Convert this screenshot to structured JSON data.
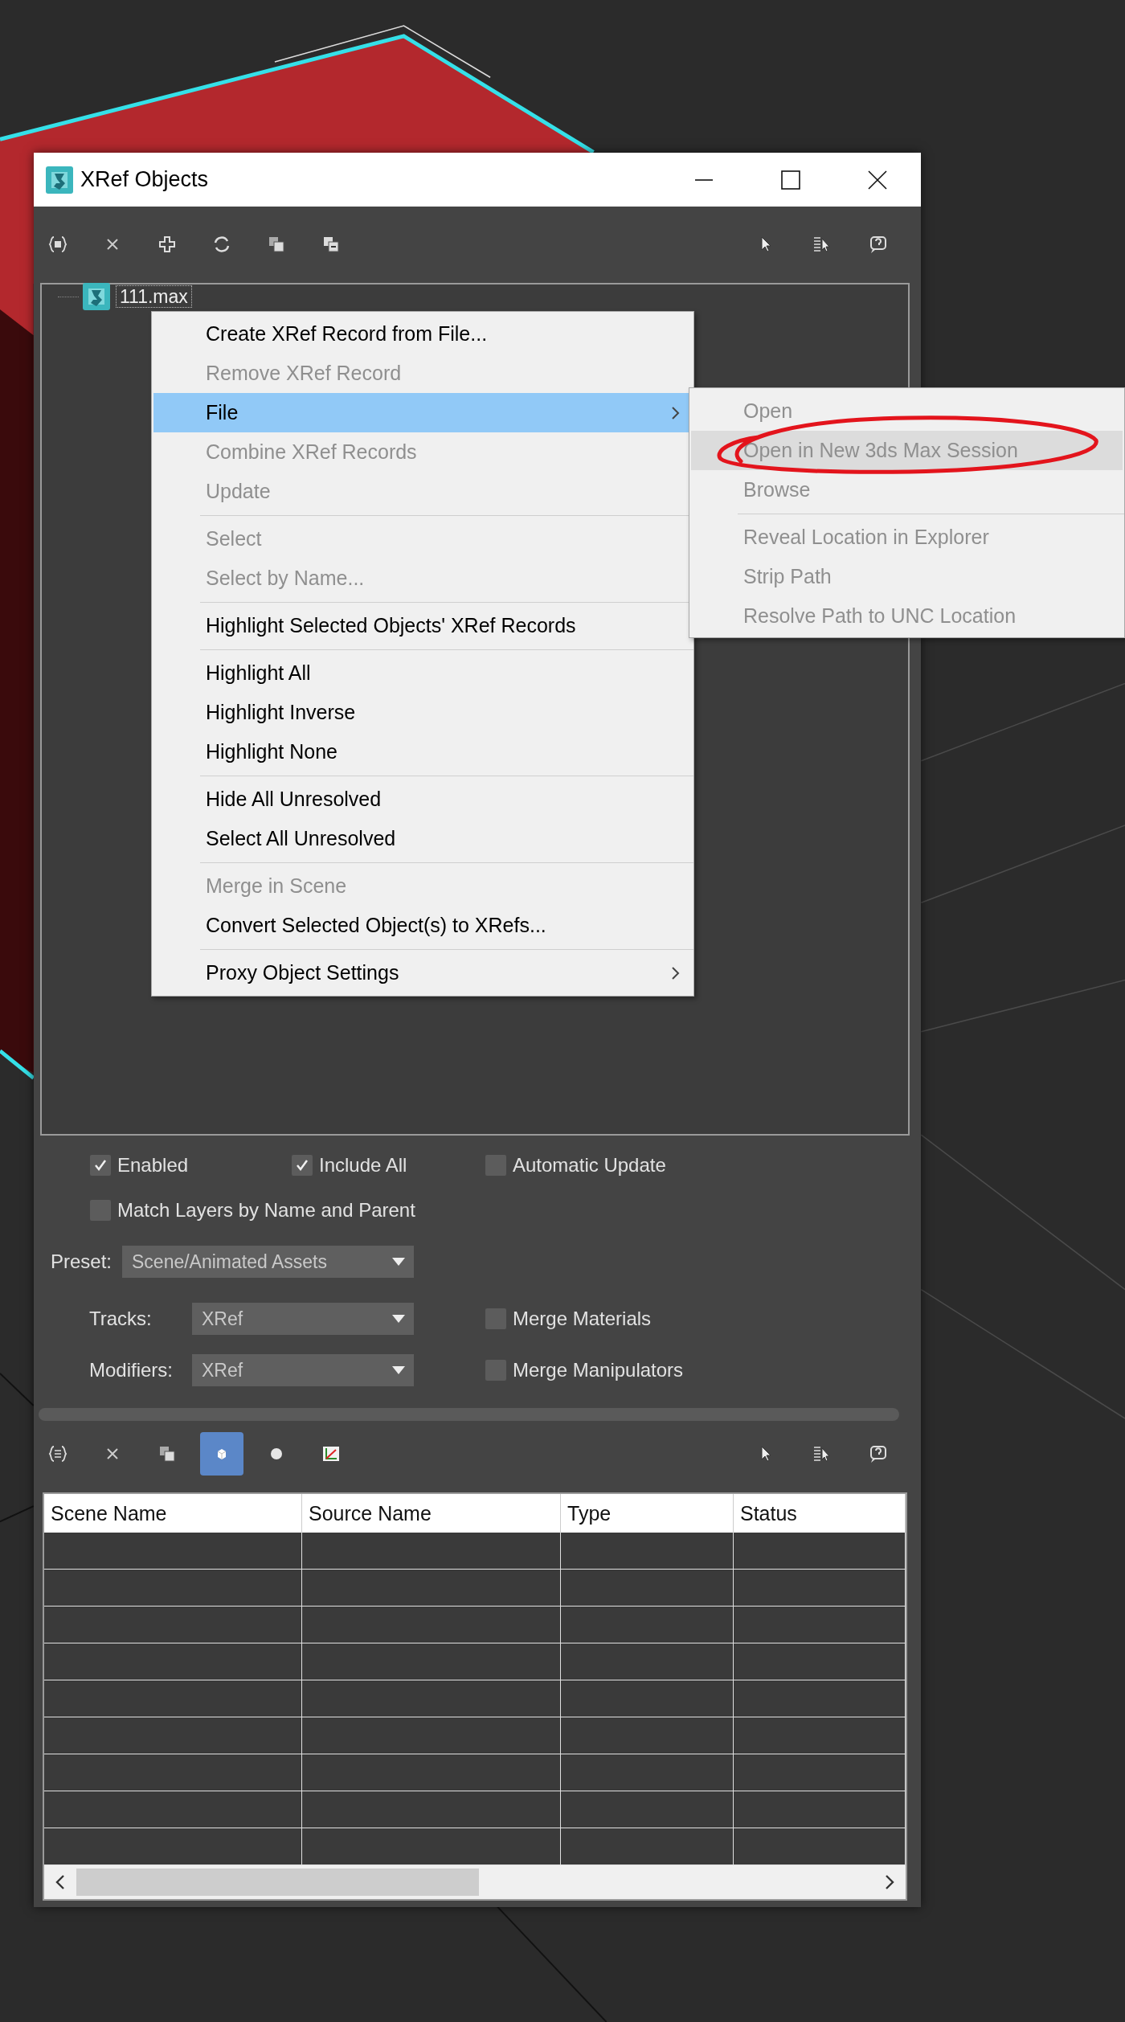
{
  "window": {
    "title": "XRef Objects"
  },
  "tree": {
    "items": [
      {
        "label": "111.max",
        "focused": true
      }
    ]
  },
  "context_menu": {
    "items": [
      {
        "kind": "item",
        "label": "Create XRef Record from File...",
        "disabled": false,
        "highlighted": false,
        "submenu": false
      },
      {
        "kind": "item",
        "label": "Remove XRef Record",
        "disabled": true,
        "highlighted": false,
        "submenu": false
      },
      {
        "kind": "item",
        "label": "File",
        "disabled": false,
        "highlighted": true,
        "submenu": true
      },
      {
        "kind": "item",
        "label": "Combine XRef Records",
        "disabled": true,
        "highlighted": false,
        "submenu": false
      },
      {
        "kind": "item",
        "label": "Update",
        "disabled": true,
        "highlighted": false,
        "submenu": false
      },
      {
        "kind": "separator"
      },
      {
        "kind": "item",
        "label": "Select",
        "disabled": true,
        "highlighted": false,
        "submenu": false
      },
      {
        "kind": "item",
        "label": "Select by Name...",
        "disabled": true,
        "highlighted": false,
        "submenu": false
      },
      {
        "kind": "separator"
      },
      {
        "kind": "item",
        "label": "Highlight Selected Objects' XRef Records",
        "disabled": false,
        "highlighted": false,
        "submenu": false
      },
      {
        "kind": "separator"
      },
      {
        "kind": "item",
        "label": "Highlight All",
        "disabled": false,
        "highlighted": false,
        "submenu": false
      },
      {
        "kind": "item",
        "label": "Highlight Inverse",
        "disabled": false,
        "highlighted": false,
        "submenu": false
      },
      {
        "kind": "item",
        "label": "Highlight None",
        "disabled": false,
        "highlighted": false,
        "submenu": false
      },
      {
        "kind": "separator"
      },
      {
        "kind": "item",
        "label": "Hide All Unresolved",
        "disabled": false,
        "highlighted": false,
        "submenu": false
      },
      {
        "kind": "item",
        "label": "Select All Unresolved",
        "disabled": false,
        "highlighted": false,
        "submenu": false
      },
      {
        "kind": "separator"
      },
      {
        "kind": "item",
        "label": "Merge in Scene",
        "disabled": true,
        "highlighted": false,
        "submenu": false
      },
      {
        "kind": "item",
        "label": "Convert Selected Object(s) to XRefs...",
        "disabled": false,
        "highlighted": false,
        "submenu": false
      },
      {
        "kind": "separator"
      },
      {
        "kind": "item",
        "label": "Proxy Object Settings",
        "disabled": false,
        "highlighted": false,
        "submenu": true
      }
    ]
  },
  "submenu": {
    "items": [
      {
        "kind": "item",
        "label": "Open",
        "disabled": true,
        "highlighted": false,
        "submenu": false
      },
      {
        "kind": "item",
        "label": "Open in New 3ds Max Session",
        "disabled": true,
        "highlighted": true,
        "submenu": false
      },
      {
        "kind": "item",
        "label": "Browse",
        "disabled": true,
        "highlighted": false,
        "submenu": false
      },
      {
        "kind": "separator"
      },
      {
        "kind": "item",
        "label": "Reveal Location in Explorer",
        "disabled": true,
        "highlighted": false,
        "submenu": false
      },
      {
        "kind": "item",
        "label": "Strip Path",
        "disabled": true,
        "highlighted": false,
        "submenu": false
      },
      {
        "kind": "item",
        "label": "Resolve Path to UNC Location",
        "disabled": true,
        "highlighted": false,
        "submenu": false
      }
    ]
  },
  "options": {
    "checkboxes": [
      {
        "label": "Enabled",
        "checked": true
      },
      {
        "label": "Include All",
        "checked": true
      },
      {
        "label": "Automatic Update",
        "checked": false
      },
      {
        "label": "Match Layers by Name and Parent",
        "checked": false
      }
    ],
    "preset": {
      "label": "Preset:",
      "value": "Scene/Animated Assets"
    },
    "tracks": {
      "label": "Tracks:",
      "value": "XRef"
    },
    "modifiers": {
      "label": "Modifiers:",
      "value": "XRef"
    },
    "merge_checkboxes": [
      {
        "label": "Merge Materials",
        "checked": false
      },
      {
        "label": "Merge Manipulators",
        "checked": false
      }
    ]
  },
  "bottom_toolbar": {
    "buttons": [
      {
        "selected": false
      },
      {
        "selected": false
      },
      {
        "selected": false
      },
      {
        "selected": true
      },
      {
        "selected": false
      },
      {
        "selected": false
      },
      {
        "selected": false
      },
      {
        "selected": false
      },
      {
        "selected": false
      }
    ]
  },
  "table": {
    "columns": [
      "Scene Name",
      "Source Name",
      "Type",
      "Status"
    ]
  }
}
